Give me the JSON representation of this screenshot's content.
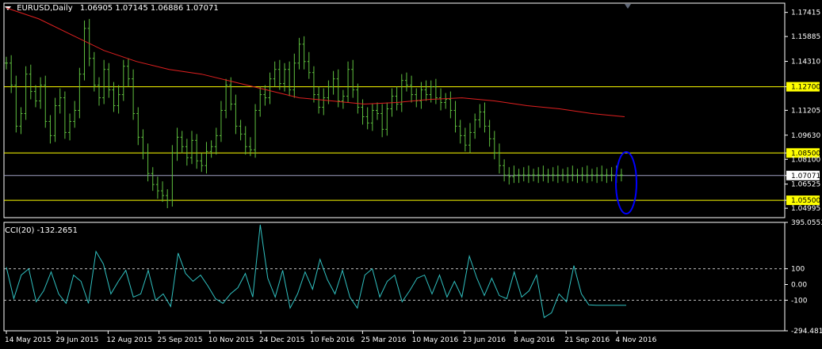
{
  "header": {
    "symbol_label": "EURUSD,Daily",
    "ohlc": "1.06905 1.07145 1.06886 1.07071",
    "cci_label": "CCI(20) -132.2651",
    "menu_icon": "triangle-down-icon"
  },
  "colors": {
    "background": "#000000",
    "frame": "#ffffff",
    "bars": "#5fbf3f",
    "ma": "#e02020",
    "level_line": "#ffff00",
    "price_line": "#a0a0c0",
    "cci": "#30c0c0",
    "highlight": "#0000ff"
  },
  "chart_data": [
    {
      "type": "line",
      "title": "EURUSD,Daily",
      "subtitle": "1.06905 1.07145 1.06886 1.07071",
      "categories": [
        "14 May 2015",
        "29 Jun 2015",
        "12 Aug 2015",
        "25 Sep 2015",
        "10 Nov 2015",
        "24 Dec 2015",
        "10 Feb 2016",
        "25 Mar 2016",
        "10 May 2016",
        "23 Jun 2016",
        "8 Aug 2016",
        "21 Sep 2016",
        "4 Nov 2016"
      ],
      "y_ticks": [
        "1.17415",
        "1.15885",
        "1.14310",
        "1.12700",
        "1.11205",
        "1.09630",
        "1.08500",
        "1.08100",
        "1.07071",
        "1.06525",
        "1.05500",
        "1.04995"
      ],
      "ylim": [
        1.044,
        1.18
      ],
      "current_price": 1.07071,
      "series": [
        {
          "role": "close",
          "x": [
            0,
            3,
            6,
            9,
            12,
            15,
            18,
            21,
            24,
            27,
            30,
            33,
            36,
            39,
            42,
            45,
            48,
            51,
            54,
            57,
            60,
            63,
            66,
            69,
            72,
            75,
            78,
            81,
            84,
            87,
            90,
            93,
            96,
            99,
            102,
            105,
            108,
            111,
            114,
            117,
            120,
            123,
            126,
            129,
            132,
            135,
            138,
            141,
            144,
            147,
            150,
            153,
            156,
            159,
            162,
            165,
            168,
            171,
            174,
            177,
            180,
            183,
            186,
            189,
            192,
            195,
            198,
            201,
            204,
            207,
            210,
            213,
            216,
            219,
            222,
            225,
            228,
            231,
            234,
            237,
            240,
            243,
            246,
            249,
            252,
            255,
            258,
            261,
            264,
            267,
            270,
            273,
            276,
            279,
            282,
            285,
            288,
            291,
            294,
            297,
            300,
            303,
            306,
            309,
            312,
            315,
            318,
            321,
            324,
            327,
            330,
            333,
            336,
            339,
            342,
            345,
            348,
            351,
            354,
            357,
            360,
            363,
            366,
            369,
            372,
            375,
            378
          ],
          "values": [
            1.142,
            1.128,
            1.102,
            1.11,
            1.135,
            1.124,
            1.118,
            1.128,
            1.105,
            1.096,
            1.115,
            1.12,
            1.098,
            1.105,
            1.112,
            1.135,
            1.164,
            1.145,
            1.128,
            1.12,
            1.138,
            1.125,
            1.115,
            1.122,
            1.14,
            1.132,
            1.11,
            1.095,
            1.085,
            1.072,
            1.065,
            1.061,
            1.058,
            1.055,
            1.085,
            1.095,
            1.089,
            1.082,
            1.093,
            1.08,
            1.077,
            1.086,
            1.089,
            1.096,
            1.112,
            1.128,
            1.116,
            1.102,
            1.097,
            1.089,
            1.087,
            1.112,
            1.122,
            1.12,
            1.132,
            1.138,
            1.129,
            1.138,
            1.125,
            1.142,
            1.154,
            1.143,
            1.136,
            1.122,
            1.114,
            1.12,
            1.127,
            1.132,
            1.118,
            1.121,
            1.138,
            1.125,
            1.114,
            1.108,
            1.104,
            1.112,
            1.11,
            1.1,
            1.113,
            1.121,
            1.116,
            1.131,
            1.128,
            1.122,
            1.118,
            1.125,
            1.122,
            1.127,
            1.12,
            1.117,
            1.119,
            1.112,
            1.102,
            1.096,
            1.09,
            1.098,
            1.106,
            1.111,
            1.102,
            1.094,
            1.085,
            1.077,
            1.071,
            1.07,
            1.071,
            1.071,
            1.071,
            1.071,
            1.071,
            1.071,
            1.071,
            1.071,
            1.071,
            1.071,
            1.071,
            1.071,
            1.071,
            1.071,
            1.071,
            1.071,
            1.071,
            1.071,
            1.071,
            1.071,
            1.071,
            1.071,
            1.071
          ]
        },
        {
          "role": "moving_average",
          "x": [
            0,
            20,
            40,
            60,
            80,
            100,
            120,
            140,
            160,
            180,
            200,
            220,
            240,
            260,
            280,
            300,
            320,
            340,
            360,
            380
          ],
          "values": [
            1.177,
            1.17,
            1.16,
            1.15,
            1.143,
            1.138,
            1.135,
            1.13,
            1.125,
            1.12,
            1.118,
            1.116,
            1.117,
            1.119,
            1.12,
            1.118,
            1.115,
            1.113,
            1.11,
            1.108
          ]
        }
      ],
      "levels": [
        1.127,
        1.085,
        1.055
      ]
    },
    {
      "type": "line",
      "title": "CCI(20) -132.2651",
      "y_ticks": [
        "395.0553",
        "100",
        "0.00",
        "-100",
        "-294.4813"
      ],
      "ylim": [
        -294.4813,
        395.0553
      ],
      "dashed_levels": [
        100,
        -100
      ],
      "series": [
        {
          "role": "cci",
          "x": [
            0,
            4,
            8,
            12,
            16,
            20,
            24,
            28,
            32,
            36,
            40,
            44,
            48,
            52,
            56,
            60,
            64,
            68,
            72,
            76,
            80,
            84,
            88,
            92,
            96,
            100,
            104,
            108,
            112,
            116,
            120,
            124,
            128,
            132,
            136,
            140,
            144,
            148,
            152,
            156,
            160,
            164,
            168,
            172,
            176,
            180,
            184,
            188,
            192,
            196,
            200,
            204,
            208,
            212,
            216,
            220,
            224,
            228,
            232,
            236,
            240,
            244,
            248,
            252,
            256,
            260,
            264,
            268,
            272,
            276,
            280,
            284,
            288,
            292,
            296,
            300,
            304,
            308,
            312,
            316,
            320,
            324,
            328,
            332
          ],
          "values": [
            110,
            -90,
            60,
            100,
            -110,
            -40,
            80,
            -60,
            -120,
            60,
            20,
            -120,
            210,
            130,
            -60,
            20,
            90,
            -80,
            -60,
            90,
            -100,
            -60,
            -140,
            200,
            70,
            20,
            60,
            -10,
            -90,
            -120,
            -60,
            -20,
            70,
            -80,
            380,
            40,
            -80,
            90,
            -150,
            -60,
            80,
            -30,
            160,
            30,
            -60,
            90,
            -80,
            -150,
            60,
            100,
            -80,
            20,
            60,
            -110,
            -40,
            40,
            60,
            -60,
            60,
            -80,
            20,
            -80,
            180,
            40,
            -70,
            40,
            -70,
            -90,
            80,
            -80,
            -40,
            60,
            -210,
            -180,
            -60,
            -110,
            120,
            -60,
            -130,
            -132,
            -132,
            -132,
            -132,
            -132
          ]
        }
      ]
    }
  ]
}
